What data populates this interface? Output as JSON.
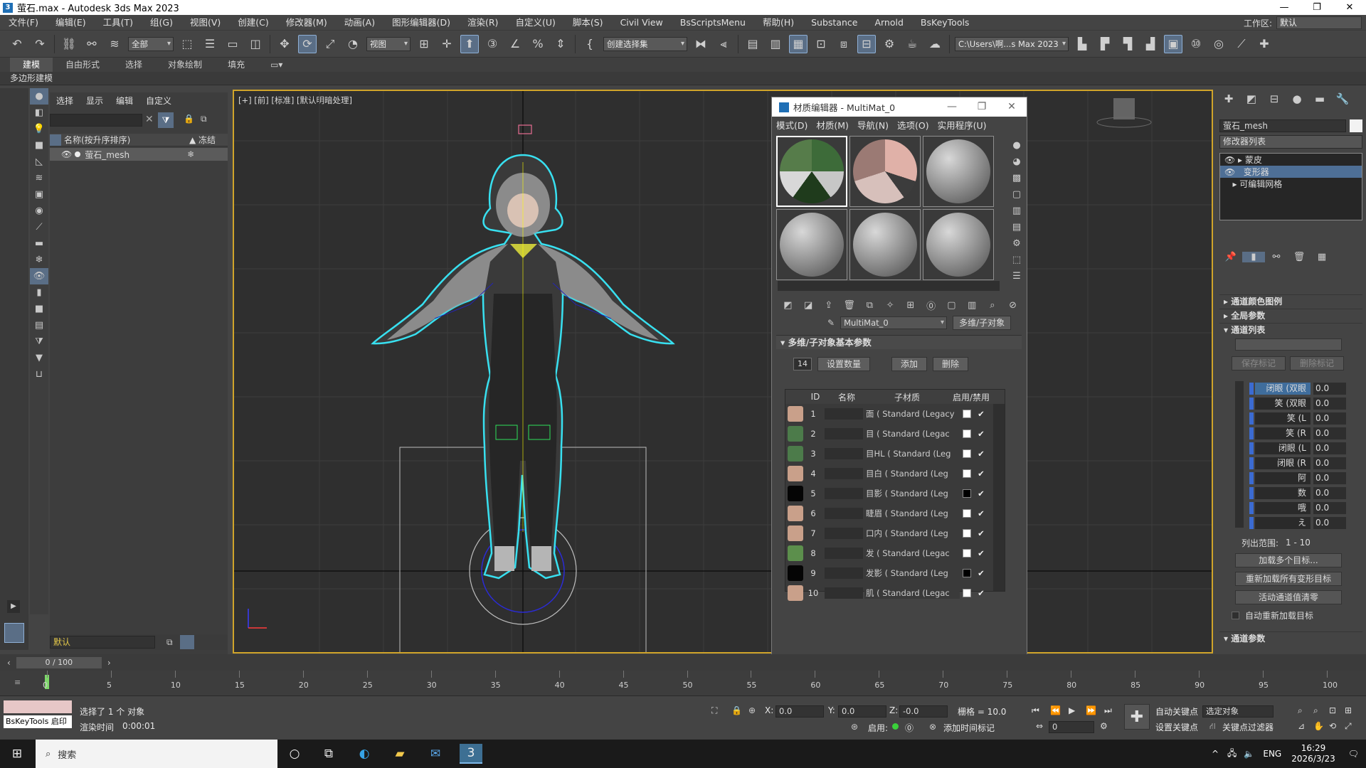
{
  "window": {
    "title": "萤石.max - Autodesk 3ds Max 2023",
    "app_icon": "3",
    "minimize": "—",
    "maximize": "❐",
    "close": "✕"
  },
  "menubar": {
    "items": [
      "文件(F)",
      "编辑(E)",
      "工具(T)",
      "组(G)",
      "视图(V)",
      "创建(C)",
      "修改器(M)",
      "动画(A)",
      "图形编辑器(D)",
      "渲染(R)",
      "自定义(U)",
      "脚本(S)",
      "Civil View",
      "BsScriptsMenu",
      "帮助(H)",
      "Substance",
      "Arnold",
      "BsKeyTools"
    ],
    "workspace_label": "工作区:",
    "workspace_value": "默认"
  },
  "toolbar": {
    "filter_select": "全部",
    "coord_select": "视图",
    "named_selection": "创建选择集",
    "path_select": "C:\\Users\\啊...s Max 2023"
  },
  "ribbon": {
    "tabs": [
      "建模",
      "自由形式",
      "选择",
      "对象绘制",
      "填充"
    ],
    "subtab": "多边形建模"
  },
  "explorer": {
    "tabs": [
      "选择",
      "显示",
      "编辑",
      "自定义"
    ],
    "col_name": "名称(按升序排序)",
    "col_freeze": "▲ 冻结",
    "object_name": "萤石_mesh",
    "layer": "默认"
  },
  "viewport": {
    "label": "[+] [前] [标准] [默认明暗处理]"
  },
  "material_editor": {
    "title": "材质编辑器 - MultiMat_0",
    "menu": [
      "模式(D)",
      "材质(M)",
      "导航(N)",
      "选项(O)",
      "实用程序(U)"
    ],
    "material_name": "MultiMat_0",
    "material_type": "多维/子对象",
    "rollout_title": "多维/子对象基本参数",
    "count": "14",
    "set_count": "设置数量",
    "add": "添加",
    "delete": "删除",
    "headers": {
      "id": "ID",
      "name": "名称",
      "sub": "子材质",
      "toggle": "启用/禁用"
    },
    "rows": [
      {
        "id": "1",
        "sub": "面 ( Standard (Legacy",
        "thumb": "#c9a08a",
        "swatch": "#ffffff",
        "check": "✔"
      },
      {
        "id": "2",
        "sub": "目 ( Standard (Legac",
        "thumb": "#4c7b4a",
        "swatch": "#ffffff",
        "check": "✔"
      },
      {
        "id": "3",
        "sub": "目HL ( Standard (Leg",
        "thumb": "#4c7b4a",
        "swatch": "#ffffff",
        "check": "✔"
      },
      {
        "id": "4",
        "sub": "目白 ( Standard (Leg",
        "thumb": "#c9a08a",
        "swatch": "#ffffff",
        "check": "✔"
      },
      {
        "id": "5",
        "sub": "目影 ( Standard (Leg",
        "thumb": "#050505",
        "swatch": "#000000",
        "check": "✔"
      },
      {
        "id": "6",
        "sub": "睫眉 ( Standard (Leg",
        "thumb": "#c9a08a",
        "swatch": "#ffffff",
        "check": "✔"
      },
      {
        "id": "7",
        "sub": "口内 ( Standard (Leg",
        "thumb": "#c9a08a",
        "swatch": "#ffffff",
        "check": "✔"
      },
      {
        "id": "8",
        "sub": "发 ( Standard (Legac",
        "thumb": "#5c8f4c",
        "swatch": "#ffffff",
        "check": "✔"
      },
      {
        "id": "9",
        "sub": "发影 ( Standard (Leg",
        "thumb": "#050505",
        "swatch": "#000000",
        "check": "✔"
      },
      {
        "id": "10",
        "sub": "肌 ( Standard (Legac",
        "thumb": "#c9a08a",
        "swatch": "#ffffff",
        "check": "✔"
      }
    ]
  },
  "command_panel": {
    "object_name": "萤石_mesh",
    "modifier_list": "修改器列表",
    "stack": [
      "蒙皮",
      "变形器",
      "可编辑网格"
    ],
    "rollouts": [
      "通道颜色图例",
      "全局参数",
      "通道列表"
    ],
    "save_marker": "保存标记",
    "delete_marker": "删除标记",
    "channels": [
      {
        "name": "闭眼 (双眼",
        "value": "0.0"
      },
      {
        "name": "笑 (双眼",
        "value": "0.0"
      },
      {
        "name": "笑 (L",
        "value": "0.0"
      },
      {
        "name": "笑 (R",
        "value": "0.0"
      },
      {
        "name": "闭眼 (L",
        "value": "0.0"
      },
      {
        "name": "闭眼 (R",
        "value": "0.0"
      },
      {
        "name": "阿",
        "value": "0.0"
      },
      {
        "name": "数",
        "value": "0.0"
      },
      {
        "name": "哦",
        "value": "0.0"
      },
      {
        "name": "え",
        "value": "0.0"
      }
    ],
    "range_label": "列出范围:",
    "range_value": "1 - 10",
    "load_multi": "加载多个目标...",
    "reload_all": "重新加载所有变形目标",
    "zero_active": "活动通道值清零",
    "auto_reload": "自动重新加载目标",
    "channel_params": "通道参数"
  },
  "timeline": {
    "frame": "0 / 100",
    "ticks": [
      "0",
      "5",
      "10",
      "15",
      "20",
      "25",
      "30",
      "35",
      "40",
      "45",
      "50",
      "55",
      "60",
      "65",
      "70",
      "75",
      "80",
      "85",
      "90",
      "95",
      "100"
    ]
  },
  "status": {
    "selected": "选择了 1 个 对象",
    "render_time_label": "渲染时间",
    "render_time": "0:00:01",
    "bskey": "BsKeyTools 启印",
    "x": "0.0",
    "y": "0.0",
    "z": "-0.0",
    "grid": "栅格 = 10.0",
    "enable": "启用:",
    "add_time_tag": "添加时间标记",
    "auto_key": "自动关键点",
    "set_key": "设置关键点",
    "key_filter": "关键点过滤器",
    "selected_obj": "选定对象",
    "frame_field": "0"
  },
  "taskbar": {
    "search": "搜索",
    "time": "16:29",
    "date": "2026/3/23",
    "lang": "ENG"
  }
}
